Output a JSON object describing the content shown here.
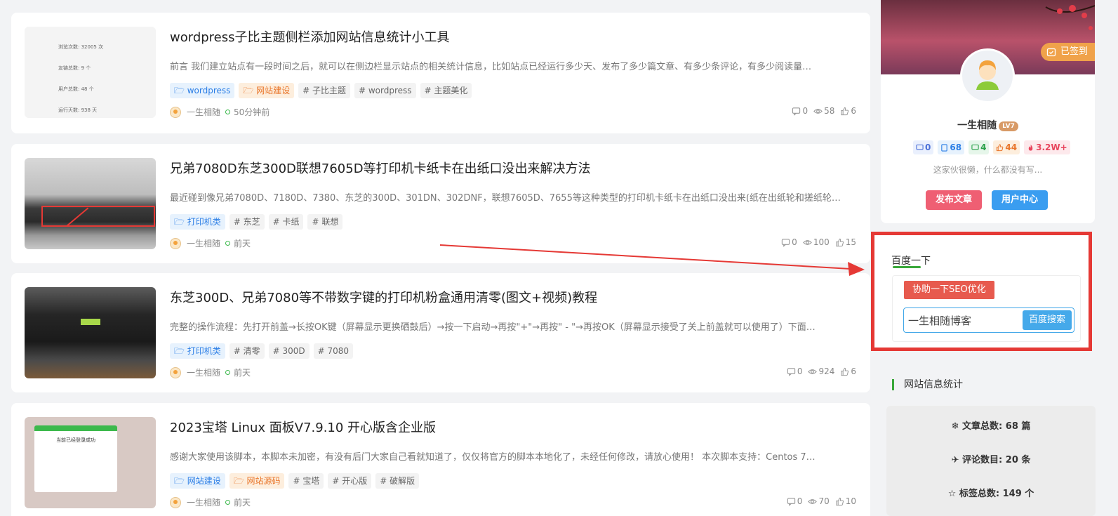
{
  "posts": [
    {
      "title": "wordpress子比主题侧栏添加网站信息统计小工具",
      "excerpt": "前言 我们建立站点有一段时间之后，就可以在侧边栏显示站点的相关统计信息，比如站点已经运行多少天、发布了多少篇文章、有多少条评论，有多少阅读量…",
      "tags": [
        {
          "text": "wordpress",
          "kind": "cat-blue"
        },
        {
          "text": "网站建设",
          "kind": "cat-orange"
        },
        {
          "text": "# 子比主题",
          "kind": "tag"
        },
        {
          "text": "# wordpress",
          "kind": "tag"
        },
        {
          "text": "# 主题美化",
          "kind": "tag"
        }
      ],
      "author": "一生相随",
      "time": "50分钟前",
      "comments": "0",
      "views": "58",
      "likes": "6",
      "thumb_lines": [
        "浏览次数: 32005 次",
        "友链总数: 9 个",
        "用户总数: 48 个",
        "运行天数: 938 天"
      ]
    },
    {
      "title": "兄弟7080D东芝300D联想7605D等打印机卡纸卡在出纸口没出来解决方法",
      "excerpt": "最近碰到像兄弟7080D、7180D、7380、东芝的300D、301DN、302DNF，联想7605D、7655等这种类型的打印机卡纸卡在出纸口没出来(纸在出纸轮和搓纸轮…",
      "tags": [
        {
          "text": "打印机类",
          "kind": "cat-blue"
        },
        {
          "text": "# 东芝",
          "kind": "tag"
        },
        {
          "text": "# 卡纸",
          "kind": "tag"
        },
        {
          "text": "# 联想",
          "kind": "tag"
        }
      ],
      "author": "一生相随",
      "time": "前天",
      "comments": "0",
      "views": "100",
      "likes": "15"
    },
    {
      "title": "东芝300D、兄弟7080等不带数字键的打印机粉盒通用清零(图文+视频)教程",
      "excerpt": "完整的操作流程：先打开前盖→长按OK键（屏幕显示更换硒鼓后）→按一下启动→再按\"+\"→再按\" - \"→再按OK（屏幕显示接受了关上前盖就可以使用了）下面…",
      "tags": [
        {
          "text": "打印机类",
          "kind": "cat-blue"
        },
        {
          "text": "# 清零",
          "kind": "tag"
        },
        {
          "text": "# 300D",
          "kind": "tag"
        },
        {
          "text": "# 7080",
          "kind": "tag"
        }
      ],
      "author": "一生相随",
      "time": "前天",
      "comments": "0",
      "views": "924",
      "likes": "6"
    },
    {
      "title": "2023宝塔 Linux 面板V7.9.10 开心版含企业版",
      "excerpt": "感谢大家使用该脚本，本脚本未加密，有没有后门大家自己看就知道了，仅仅将官方的脚本本地化了，未经任何修改，请放心使用！ 本次脚本支持：Centos 7…",
      "tags": [
        {
          "text": "网站建设",
          "kind": "cat-blue"
        },
        {
          "text": "网站源码",
          "kind": "cat-orange"
        },
        {
          "text": "# 宝塔",
          "kind": "tag"
        },
        {
          "text": "# 开心版",
          "kind": "tag"
        },
        {
          "text": "# 破解版",
          "kind": "tag"
        }
      ],
      "author": "一生相随",
      "time": "前天",
      "comments": "0",
      "views": "70",
      "likes": "10",
      "thumb_lines": [
        "当前已经登录成功"
      ]
    }
  ],
  "profile": {
    "checkin": "已签到",
    "username": "一生相随",
    "level": "LV7",
    "counts": [
      {
        "value": "0",
        "color": "#4a6fd8",
        "bg": "#eaf0fd"
      },
      {
        "value": "68",
        "color": "#2b7ee6",
        "bg": "#e7f2fd"
      },
      {
        "value": "4",
        "color": "#2aa14a",
        "bg": "#e6f6ea"
      },
      {
        "value": "44",
        "color": "#e9762b",
        "bg": "#fdeedd"
      },
      {
        "value": "3.2W+",
        "color": "#e8465e",
        "bg": "#fde9ec"
      }
    ],
    "bio": "这家伙很懒，什么都没有写...",
    "publish_btn": "发布文章",
    "user_center_btn": "用户中心"
  },
  "baidu": {
    "title": "百度一下",
    "seo_label": "协助一下SEO优化",
    "search_value": "一生相随博客",
    "search_btn": "百度搜索"
  },
  "site_stats": {
    "title": "网站信息统计",
    "items": [
      "文章总数: 68 篇",
      "评论数目: 20 条",
      "标签总数: 149 个"
    ]
  },
  "colors": {
    "accent_green": "#39a83a",
    "highlight_red": "#e53935",
    "publish": "#ef5f73",
    "user_center": "#3a9df0"
  }
}
